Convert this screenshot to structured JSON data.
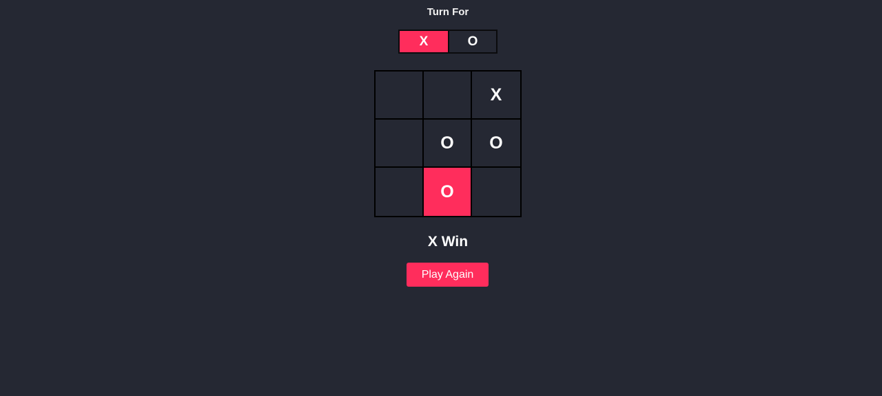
{
  "turn": {
    "title": "Turn For",
    "options": [
      "X",
      "O"
    ],
    "active": "X"
  },
  "board": {
    "cells": [
      "",
      "",
      "X",
      "",
      "O",
      "O",
      "",
      "O",
      ""
    ],
    "highlighted": [
      7
    ]
  },
  "result": {
    "text": "X Win"
  },
  "actions": {
    "play_again_label": "Play Again"
  },
  "colors": {
    "background": "#252833",
    "accent": "#ff2d5c",
    "grid": "#000000",
    "text": "#ffffff"
  }
}
